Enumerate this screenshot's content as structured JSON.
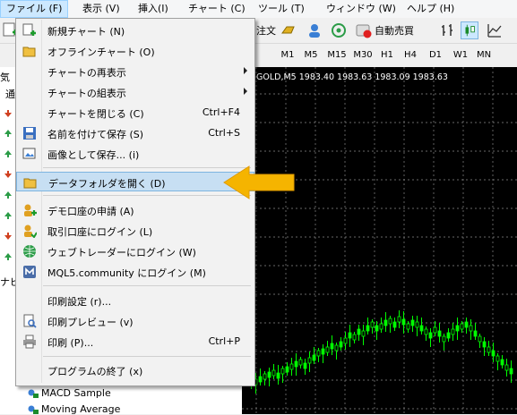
{
  "menubar": {
    "items": [
      "ファイル (F)",
      "表示 (V)",
      "挿入(I)",
      "チャート (C)",
      "ツール (T)",
      "ウィンドウ (W)",
      "ヘルプ (H)"
    ]
  },
  "toolbar": {
    "partial_label": "注文",
    "autotrade_label": "自動売買",
    "timeframes": [
      "M1",
      "M5",
      "M15",
      "M30",
      "H1",
      "H4",
      "D1",
      "W1",
      "MN"
    ]
  },
  "left_panel": {
    "tab_partial_1": "気",
    "tab_partial_2": "通",
    "nav_partial": "ナビ",
    "nav_items": [
      "MACD Sample",
      "Moving Average"
    ]
  },
  "chart": {
    "title": "GOLD,M5  1983.40 1983.63 1983.09 1983.63"
  },
  "file_menu": {
    "items": [
      {
        "label": "新規チャート (N)",
        "shortcut": "",
        "submenu": false,
        "icon": "new-chart-icon"
      },
      {
        "label": "オフラインチャート (O)",
        "shortcut": "",
        "submenu": false,
        "icon": "open-folder-icon"
      },
      {
        "label": "チャートの再表示",
        "shortcut": "",
        "submenu": true,
        "icon": ""
      },
      {
        "label": "チャートの組表示",
        "shortcut": "",
        "submenu": true,
        "icon": ""
      },
      {
        "label": "チャートを閉じる (C)",
        "shortcut": "Ctrl+F4",
        "submenu": false,
        "icon": ""
      },
      {
        "label": "名前を付けて保存 (S)",
        "shortcut": "Ctrl+S",
        "submenu": false,
        "icon": "save-icon"
      },
      {
        "label": "画像として保存... (i)",
        "shortcut": "",
        "submenu": false,
        "icon": "save-image-icon"
      },
      {
        "label": "データフォルダを開く (D)",
        "shortcut": "",
        "submenu": false,
        "icon": "data-folder-icon",
        "highlighted": true
      },
      {
        "label": "デモ口座の申請 (A)",
        "shortcut": "",
        "submenu": false,
        "icon": "demo-account-icon"
      },
      {
        "label": "取引口座にログイン (L)",
        "shortcut": "",
        "submenu": false,
        "icon": "login-account-icon"
      },
      {
        "label": "ウェブトレーダーにログイン (W)",
        "shortcut": "",
        "submenu": false,
        "icon": "webtrader-icon"
      },
      {
        "label": "MQL5.community にログイン (M)",
        "shortcut": "",
        "submenu": false,
        "icon": "mql5-icon"
      },
      {
        "label": "印刷設定 (r)...",
        "shortcut": "",
        "submenu": false,
        "icon": ""
      },
      {
        "label": "印刷プレビュー (v)",
        "shortcut": "",
        "submenu": false,
        "icon": "print-preview-icon"
      },
      {
        "label": "印刷 (P)...",
        "shortcut": "Ctrl+P",
        "submenu": false,
        "icon": "print-icon"
      },
      {
        "label": "プログラムの終了 (x)",
        "shortcut": "",
        "submenu": false,
        "icon": ""
      }
    ]
  },
  "colors": {
    "highlight": "#c7dff3",
    "callout_arrow": "#f5b400",
    "candle_up": "#00ff00",
    "chart_bg": "#000000",
    "grid": "#8a8a8a"
  }
}
